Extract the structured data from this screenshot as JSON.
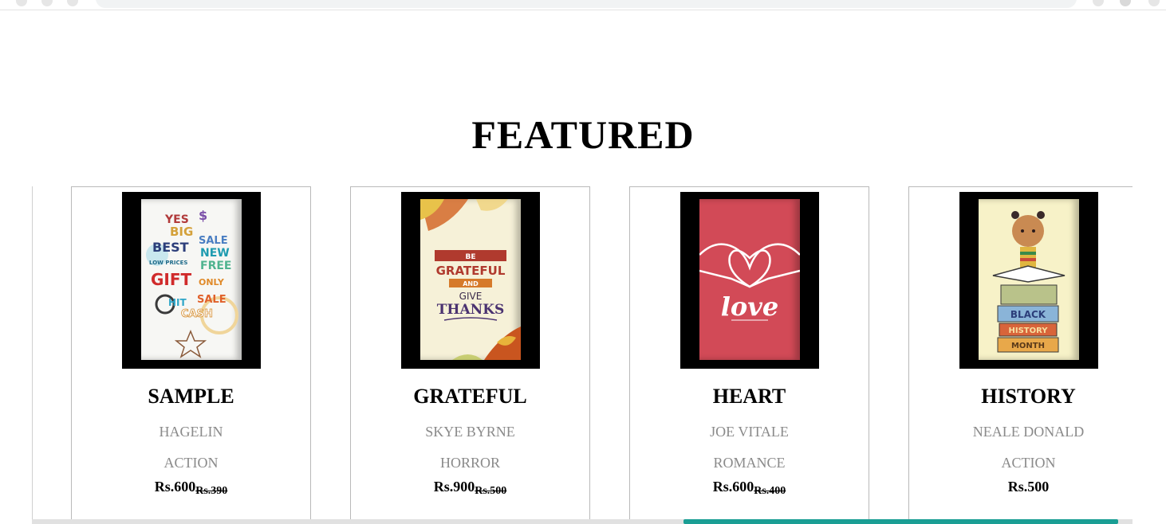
{
  "section": {
    "title": "FEATURED"
  },
  "books": [
    {
      "title": "SAMPLE",
      "author": "HAGELIN",
      "genre": "ACTION",
      "price": "Rs.600",
      "old_price": "Rs.390",
      "cover": {
        "theme": "sale-typography",
        "words": [
          "YES",
          "BIG",
          "SALE",
          "BEST",
          "NEW",
          "LOW PRICES",
          "FREE",
          "GIFT",
          "ONLY",
          "HIT",
          "SALE",
          "CASH"
        ]
      }
    },
    {
      "title": "GRATEFUL",
      "author": "SKYE BYRNE",
      "genre": "HORROR",
      "price": "Rs.900",
      "old_price": "Rs.500",
      "cover": {
        "theme": "autumn-leaves",
        "words": [
          "BE",
          "GRATEFUL",
          "AND",
          "GIVE",
          "THANKS"
        ]
      }
    },
    {
      "title": "HEART",
      "author": "JOE VITALE",
      "genre": "ROMANCE",
      "price": "Rs.600",
      "old_price": "Rs.400",
      "cover": {
        "theme": "heart-hands",
        "words": [
          "love"
        ]
      }
    },
    {
      "title": "HISTORY",
      "author": "NEALE DONALD",
      "genre": "ACTION",
      "price": "Rs.500",
      "old_price": "",
      "cover": {
        "theme": "child-reading-books",
        "words": [
          "BLACK",
          "HISTORY",
          "MONTH"
        ]
      }
    }
  ],
  "colors": {
    "accent": "#1a9e94",
    "muted_text": "#8a8a8a",
    "card_border": "#b9b9b9"
  },
  "scroll": {
    "position_fraction": 0.59,
    "visible_fraction": 0.4
  }
}
